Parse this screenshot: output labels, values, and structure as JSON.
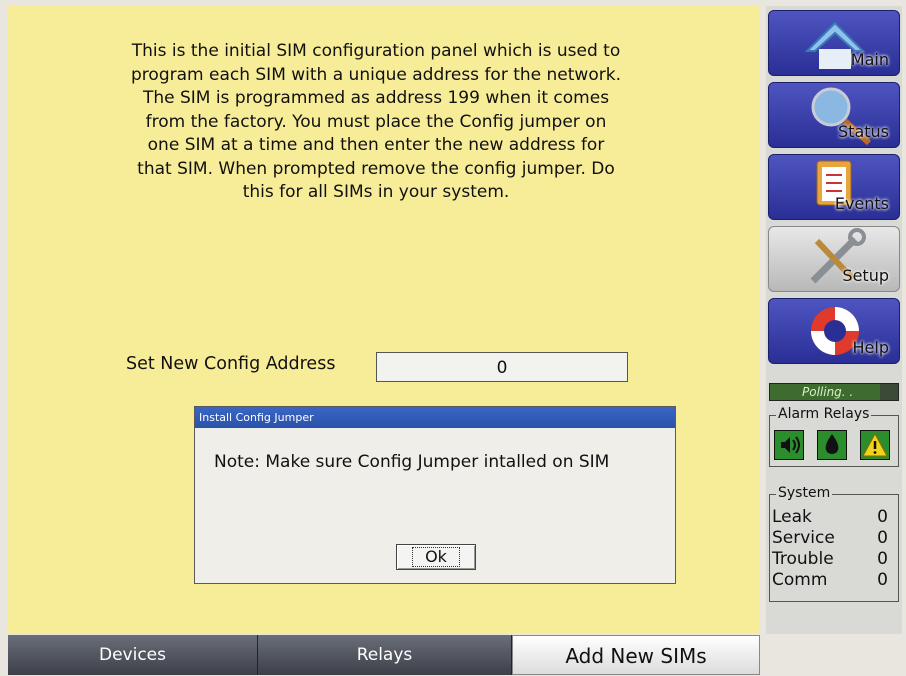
{
  "main": {
    "intro_text": "This is the initial SIM configuration panel which is used to program each SIM with a unique address for the network. The SIM is programmed as address 199 when it comes from the factory. You must place the Config jumper on one SIM at a time and then enter the new address for that SIM. When prompted remove the config jumper. Do this for all SIMs in your system.",
    "address_label": "Set New Config Address",
    "address_value": "0"
  },
  "dialog": {
    "title": "Install Config Jumper",
    "message": "Note: Make sure Config Jumper intalled on SIM",
    "ok_label": "Ok"
  },
  "tabs": [
    {
      "label": "Devices",
      "active": false
    },
    {
      "label": "Relays",
      "active": false
    },
    {
      "label": "Add New SIMs",
      "active": true
    }
  ],
  "sidebar": {
    "nav": [
      {
        "label": "Main",
        "icon": "house-icon",
        "active": false
      },
      {
        "label": "Status",
        "icon": "magnifier-icon",
        "active": false
      },
      {
        "label": "Events",
        "icon": "clipboard-icon",
        "active": false
      },
      {
        "label": "Setup",
        "icon": "tools-icon",
        "active": true
      },
      {
        "label": "Help",
        "icon": "lifebuoy-icon",
        "active": false
      }
    ],
    "polling_text": "Polling. .",
    "polling_progress": 0.86,
    "alarm_relays_title": "Alarm Relays",
    "relay_icons": [
      "speaker-icon",
      "water-drop-icon",
      "warning-icon"
    ],
    "system_title": "System",
    "system_rows": [
      {
        "label": "Leak",
        "value": "0"
      },
      {
        "label": "Service",
        "value": "0"
      },
      {
        "label": "Trouble",
        "value": "0"
      },
      {
        "label": "Comm",
        "value": "0"
      }
    ]
  },
  "colors": {
    "panel_background": "#f7ec98",
    "nav_button": "#3a3fa8",
    "dialog_title": "#2f5cb8",
    "relay_green": "#2c8d2c",
    "warning_yellow": "#f2d21b"
  }
}
